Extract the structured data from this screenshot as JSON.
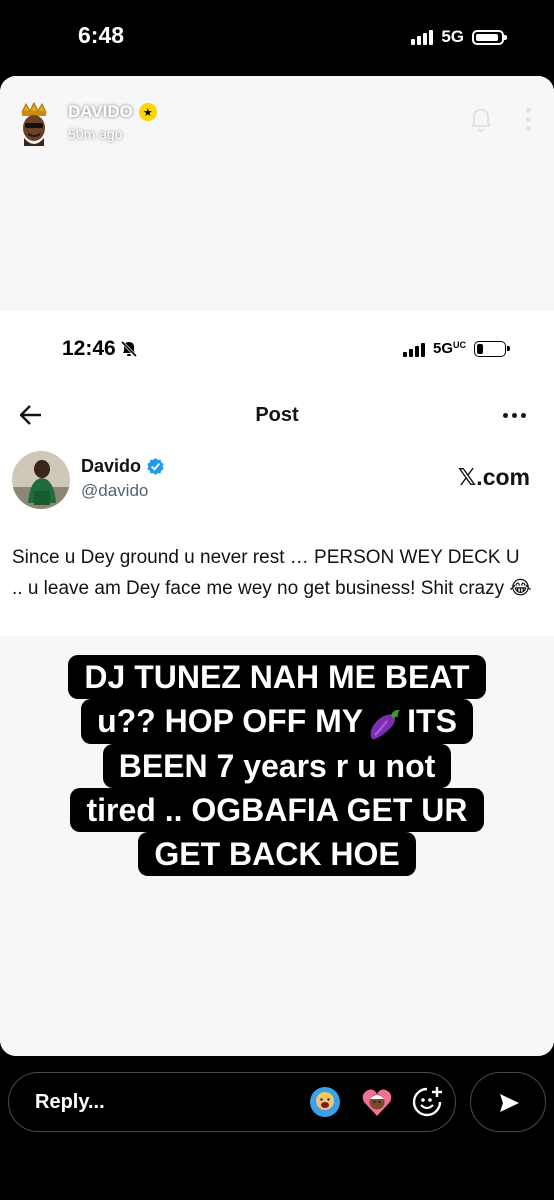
{
  "os_status": {
    "time": "6:48",
    "network": "5G",
    "battery_pct": 85
  },
  "story": {
    "username": "DAVIDO",
    "time_ago": "50m ago",
    "badge_color": "#ffd500"
  },
  "inner_status": {
    "time": "12:46",
    "network": "5G",
    "battery_pct": 25
  },
  "post": {
    "header_title": "Post",
    "author_name": "Davido",
    "author_handle": "@davido",
    "verified_color": "#1d9bf0",
    "watermark": "𝕏.com",
    "text": "Since u Dey ground u never rest … PERSON WEY DECK U .. u leave am Dey face me wey no get business! Shit crazy 😂"
  },
  "caption": {
    "line1": "DJ TUNEZ NAH ME BEAT",
    "line2_a": "u?? HOP OFF MY",
    "line2_emoji": "eggplant",
    "line2_b": "ITS",
    "line3": "BEEN 7 years r u not",
    "line4": "tired .. OGBAFIA GET UR",
    "line5": "GET BACK HOE"
  },
  "reply_bar": {
    "placeholder": "Reply...",
    "icons": [
      "bitmoji-cheer-icon",
      "bitmoji-heart-icon",
      "sticker-add-icon",
      "send-icon"
    ]
  }
}
